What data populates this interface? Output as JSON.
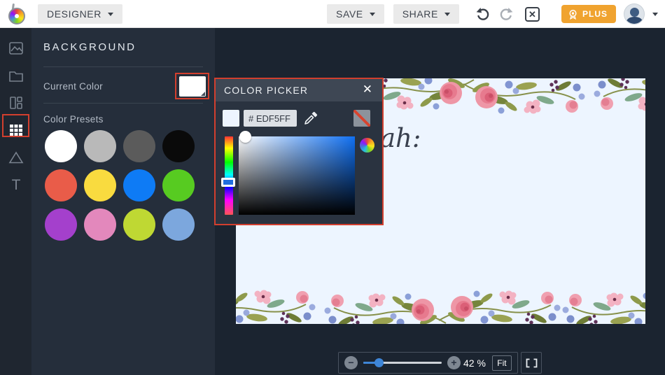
{
  "topbar": {
    "designer_label": "DESIGNER",
    "save_label": "SAVE",
    "share_label": "SHARE",
    "plus_label": "PLUS",
    "close_glyph": "✕"
  },
  "sidebar": {
    "items": [
      {
        "name": "image",
        "icon": "image-icon",
        "active": false
      },
      {
        "name": "manager",
        "icon": "folder-icon",
        "active": false
      },
      {
        "name": "layouts",
        "icon": "layout-icon",
        "active": false
      },
      {
        "name": "patterns",
        "icon": "grid-icon",
        "active": true
      },
      {
        "name": "shapes",
        "icon": "triangle-icon",
        "active": false
      },
      {
        "name": "text",
        "icon": "text-icon",
        "active": false
      }
    ]
  },
  "panel": {
    "title": "BACKGROUND",
    "current_color_label": "Current Color",
    "current_color_hex": "#FFFFFF",
    "color_presets_label": "Color Presets",
    "presets": [
      {
        "name": "white",
        "hex": "#FFFFFF"
      },
      {
        "name": "light-gray",
        "hex": "#B9B9B9"
      },
      {
        "name": "dark-gray",
        "hex": "#5B5B5B"
      },
      {
        "name": "black",
        "hex": "#0A0A0A"
      },
      {
        "name": "red",
        "hex": "#E95C49"
      },
      {
        "name": "yellow",
        "hex": "#F9DB3F"
      },
      {
        "name": "blue",
        "hex": "#0E7BF5"
      },
      {
        "name": "green",
        "hex": "#57CB21"
      },
      {
        "name": "purple",
        "hex": "#A440CC"
      },
      {
        "name": "pink",
        "hex": "#E388BC"
      },
      {
        "name": "chartreuse",
        "hex": "#BFD833"
      },
      {
        "name": "light-blue",
        "hex": "#7CA7DD"
      }
    ]
  },
  "picker": {
    "title": "COLOR PICKER",
    "close_glyph": "✕",
    "hex_value": "# EDF5FF",
    "selected_hex": "#EDF5FF"
  },
  "canvas": {
    "background_hex": "#EDF5FF",
    "visible_text": "ah:"
  },
  "zoombar": {
    "minus_glyph": "−",
    "plus_glyph": "+",
    "zoom_percent": "42 %",
    "fit_label": "Fit"
  },
  "colors": {
    "highlight_red": "#D23F2E",
    "plus_orange": "#F0A32F",
    "slider_blue": "#3E86D8",
    "workspace_bg": "#1B2430",
    "panel_bg": "#252E3B"
  }
}
